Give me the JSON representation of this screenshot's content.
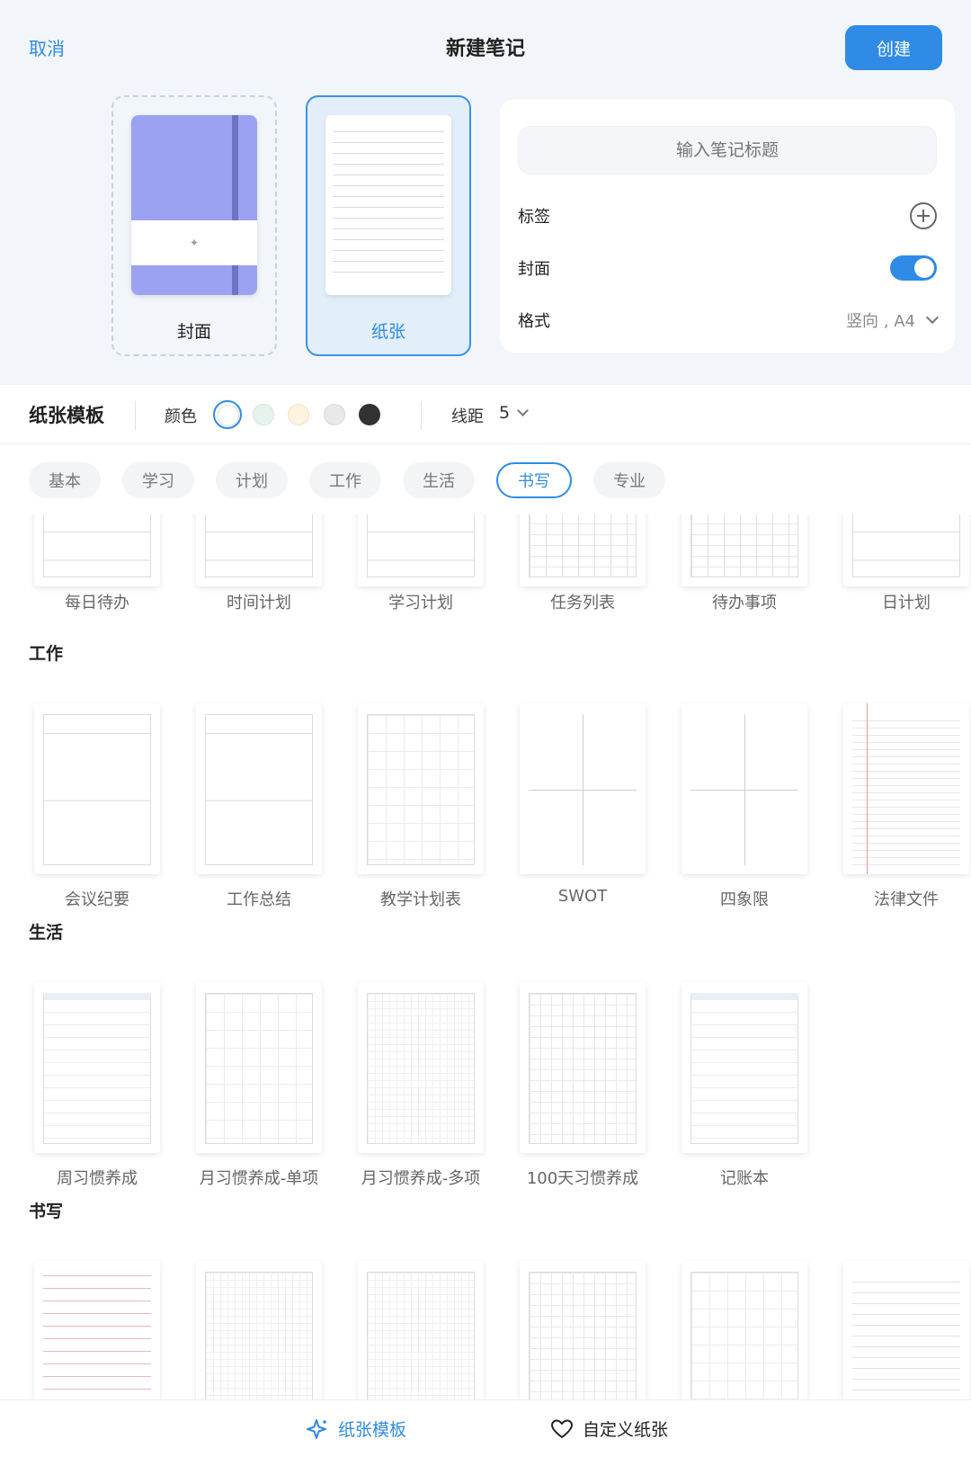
{
  "header": {
    "cancel_label": "取消",
    "title": "新建笔记",
    "create_label": "创建"
  },
  "cards": {
    "cover_label": "封面",
    "paper_label": "纸张"
  },
  "settings": {
    "title_placeholder": "输入笔记标题",
    "tags_label": "标签",
    "cover_label": "封面",
    "cover_enabled": true,
    "format_label": "格式",
    "format_value": "竖向 , A4"
  },
  "toolbar": {
    "title": "纸张模板",
    "color_label": "颜色",
    "colors": [
      "#ffffff",
      "#e6f3ec",
      "#fdf3e0",
      "#e9e9ec",
      "#333333"
    ],
    "selected_color": "#ffffff",
    "spacing_label": "线距",
    "spacing_value": "5"
  },
  "tabs": [
    "基本",
    "学习",
    "计划",
    "工作",
    "生活",
    "书写",
    "专业"
  ],
  "active_tab": "书写",
  "sections": {
    "plan_items": [
      "每日待办",
      "时间计划",
      "学习计划",
      "任务列表",
      "待办事项",
      "日计划"
    ],
    "work_title": "工作",
    "work_items": [
      "会议纪要",
      "工作总结",
      "教学计划表",
      "SWOT",
      "四象限",
      "法律文件"
    ],
    "life_title": "生活",
    "life_items": [
      "周习惯养成",
      "月习惯养成-单项",
      "月习惯养成-多项",
      "100天习惯养成",
      "记账本"
    ],
    "writing_title": "书写"
  },
  "bottom_bar": {
    "templates_label": "纸张模板",
    "custom_label": "自定义纸张"
  },
  "colors": {
    "accent": "#2f8be6",
    "cover_purple": "#9ba2f1"
  }
}
